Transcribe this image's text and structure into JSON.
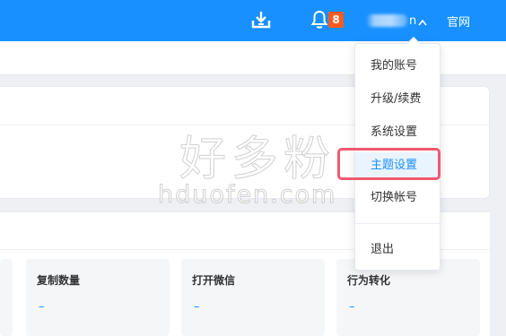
{
  "header": {
    "notification_count": "8",
    "username_suffix": "n",
    "site_link": "官网",
    "icons": {
      "download": "download-icon",
      "bell": "bell-icon",
      "caret": "chevron-up-icon"
    }
  },
  "watermark": {
    "cn": "好多粉",
    "en": "hduofen.com"
  },
  "stats": [
    {
      "title": "复制数量",
      "value": "–"
    },
    {
      "title": "打开微信",
      "value": "–"
    },
    {
      "title": "行为转化",
      "value": "–"
    }
  ],
  "dropdown": {
    "items": [
      "我的账号",
      "升级/续费",
      "系统设置",
      "主题设置",
      "切换帐号"
    ],
    "logout": "退出",
    "active_index": 3
  },
  "colors": {
    "brand": "#1890ff",
    "badge": "#ff5a1f",
    "highlight": "#f0596f"
  }
}
